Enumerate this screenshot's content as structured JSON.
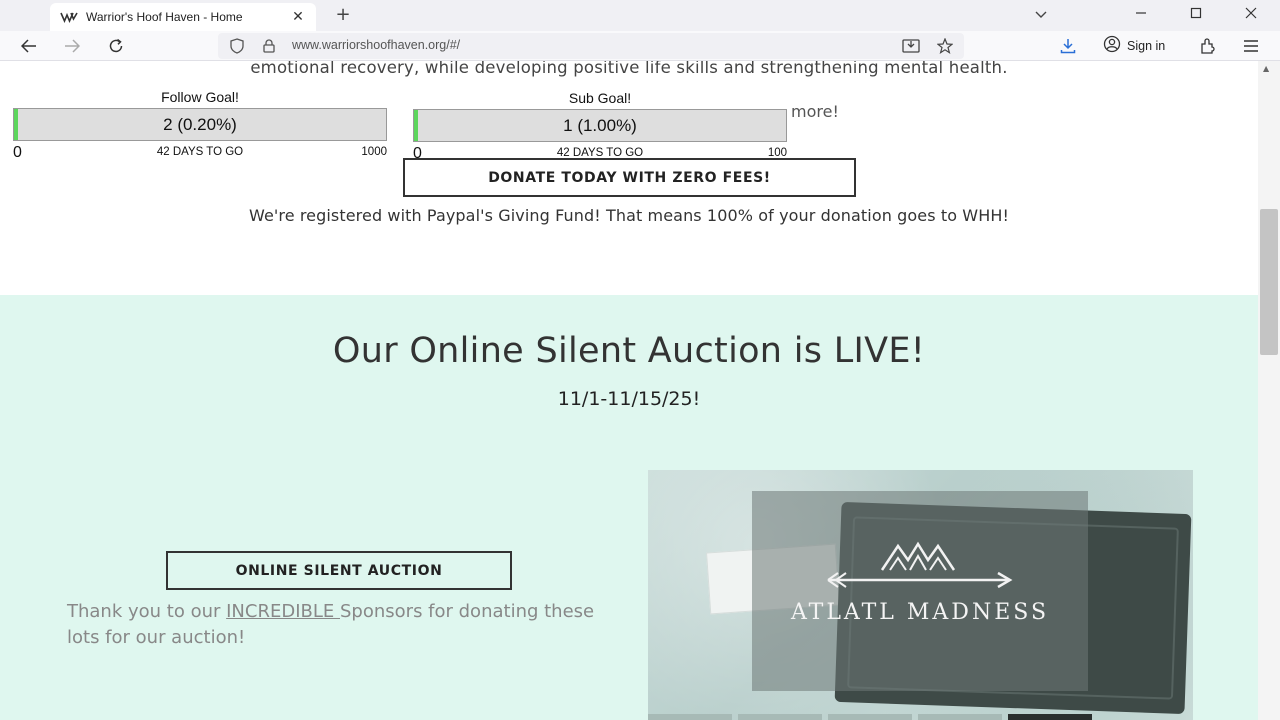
{
  "browser": {
    "tab_title": "Warrior's Hoof Haven - Home",
    "url": "www.warriorshoofhaven.org/#/",
    "sign_in_label": "Sign in",
    "icons": [
      "back-icon",
      "forward-icon",
      "reload-icon",
      "shield-icon",
      "lock-icon",
      "reader-view-icon",
      "bookmark-star-icon",
      "download-icon",
      "account-icon",
      "extensions-icon",
      "menu-icon"
    ]
  },
  "page": {
    "intro_line": "emotional recovery, while developing positive life skills and strengthening mental health.",
    "follow_goal": {
      "title": "Follow Goal!",
      "value_label": "2 (0.20%)",
      "progress": 0.002,
      "min": "0",
      "days_to_go": "42 DAYS TO GO",
      "max": "1000"
    },
    "sub_goal": {
      "title": "Sub Goal!",
      "value_label": "1 (1.00%)",
      "progress": 0.01,
      "min": "0",
      "days_to_go": "42 DAYS TO GO",
      "max": "100"
    },
    "partial_text_right": "more!",
    "donate_button": "DONATE TODAY WITH ZERO FEES!",
    "paypal_line": "We're registered with Paypal's Giving Fund! That means 100% of your donation goes to WHH!",
    "auction": {
      "heading": "Our Online Silent Auction is LIVE!",
      "dates": "11/1-11/15/25!",
      "button": "ONLINE SILENT AUCTION",
      "thanks_before": "Thank you to our ",
      "thanks_link": "INCREDIBLE ",
      "thanks_after": "Sponsors for donating these lots for our auction!",
      "image_logo_text": "ATLATL MADNESS"
    }
  },
  "colors": {
    "auction_bg": "#dff7ef",
    "progress_fill": "#5cd65c",
    "progress_track": "#dedede"
  }
}
